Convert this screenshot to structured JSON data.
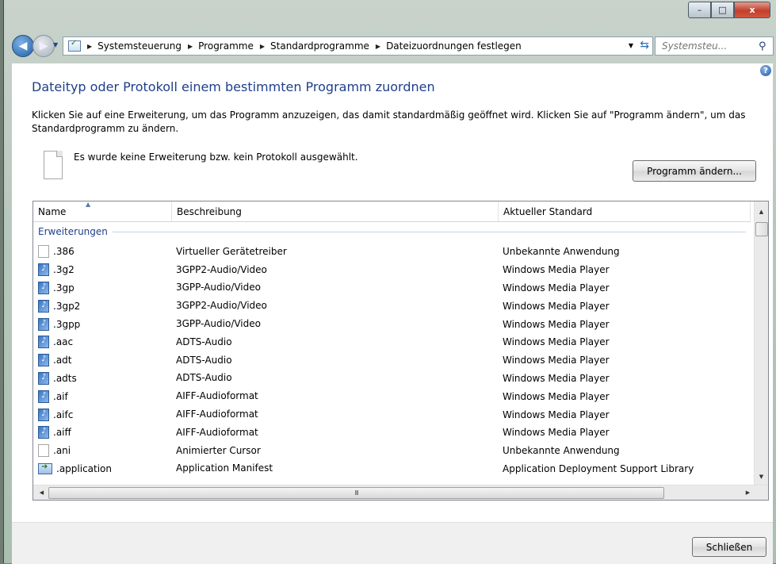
{
  "window": {
    "minimize": "–",
    "maximize": "□",
    "close": "x"
  },
  "nav": {
    "back": "◀",
    "forward": "▶",
    "breadcrumb": [
      "Systemsteuerung",
      "Programme",
      "Standardprogramme",
      "Dateizuordnungen festlegen"
    ],
    "search_placeholder": "Systemsteu..."
  },
  "page": {
    "help": "?",
    "title": "Dateityp oder Protokoll einem bestimmten Programm zuordnen",
    "description": "Klicken Sie auf eine Erweiterung, um das Programm anzuzeigen, das damit standardmäßig geöffnet wird. Klicken Sie auf \"Programm ändern\", um das Standardprogramm zu ändern.",
    "selection_text": "Es wurde keine Erweiterung bzw. kein Protokoll ausgewählt.",
    "change_button": "Programm ändern...",
    "close_button": "Schließen"
  },
  "table": {
    "columns": [
      "Name",
      "Beschreibung",
      "Aktueller Standard"
    ],
    "group": "Erweiterungen",
    "rows": [
      {
        "icon": "blank",
        "name": ".386",
        "desc": "Virtueller Gerätetreiber",
        "std": "Unbekannte Anwendung"
      },
      {
        "icon": "media",
        "name": ".3g2",
        "desc": "3GPP2-Audio/Video",
        "std": "Windows Media Player"
      },
      {
        "icon": "media",
        "name": ".3gp",
        "desc": "3GPP-Audio/Video",
        "std": "Windows Media Player"
      },
      {
        "icon": "media",
        "name": ".3gp2",
        "desc": "3GPP2-Audio/Video",
        "std": "Windows Media Player"
      },
      {
        "icon": "media",
        "name": ".3gpp",
        "desc": "3GPP-Audio/Video",
        "std": "Windows Media Player"
      },
      {
        "icon": "media",
        "name": ".aac",
        "desc": "ADTS-Audio",
        "std": "Windows Media Player"
      },
      {
        "icon": "media",
        "name": ".adt",
        "desc": "ADTS-Audio",
        "std": "Windows Media Player"
      },
      {
        "icon": "media",
        "name": ".adts",
        "desc": "ADTS-Audio",
        "std": "Windows Media Player"
      },
      {
        "icon": "media",
        "name": ".aif",
        "desc": "AIFF-Audioformat",
        "std": "Windows Media Player"
      },
      {
        "icon": "media",
        "name": ".aifc",
        "desc": "AIFF-Audioformat",
        "std": "Windows Media Player"
      },
      {
        "icon": "media",
        "name": ".aiff",
        "desc": "AIFF-Audioformat",
        "std": "Windows Media Player"
      },
      {
        "icon": "blank",
        "name": ".ani",
        "desc": "Animierter Cursor",
        "std": "Unbekannte Anwendung"
      },
      {
        "icon": "app",
        "name": ".application",
        "desc": "Application Manifest",
        "std": "Application Deployment Support Library"
      }
    ]
  },
  "scrollbars": {
    "up": "▲",
    "down": "▼",
    "left": "◀",
    "right": "▶",
    "grip": "III"
  }
}
